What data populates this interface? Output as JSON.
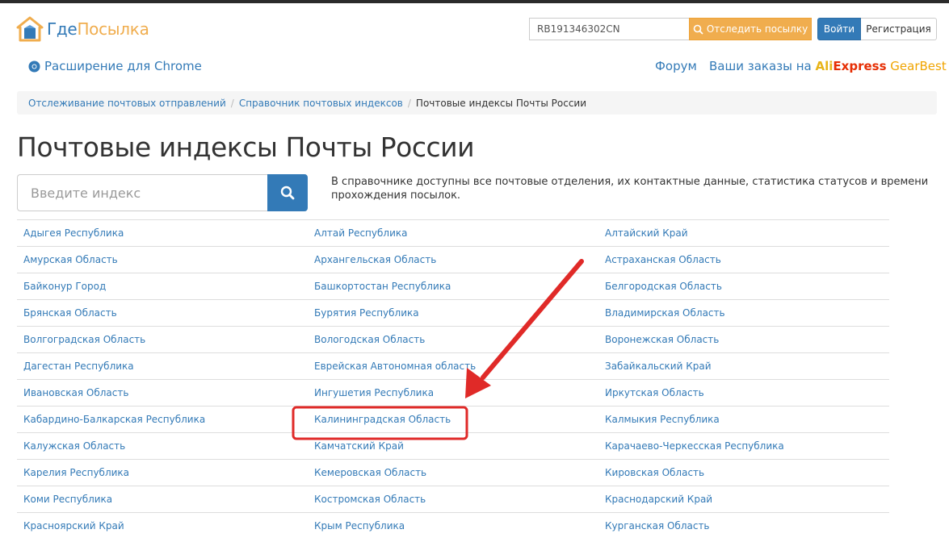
{
  "header": {
    "logo_text_1": "Где",
    "logo_text_2": "Посылка",
    "track_input_value": "RB191346302CN",
    "track_button_label": "Отследить посылку",
    "login_label": "Войти",
    "register_label": "Регистрация"
  },
  "subnav": {
    "chrome_extension": "Расширение для Chrome",
    "forum": "Форум",
    "orders_prefix": "Ваши заказы на",
    "aliexpress_1": "Ali",
    "aliexpress_2": "Express",
    "gearbest": "GearBest"
  },
  "breadcrumb": {
    "item_1": "Отслеживание почтовых отправлений",
    "item_2": "Справочник почтовых индексов",
    "current": "Почтовые индексы Почты России"
  },
  "page": {
    "title": "Почтовые индексы Почты России",
    "search_placeholder": "Введите индекс",
    "description": "В справочнике доступны все почтовые отделения, их контактные данные, статистика статусов и времени прохождения посылок."
  },
  "regions": [
    [
      "Адыгея Республика",
      "Алтай Республика",
      "Алтайский Край"
    ],
    [
      "Амурская Область",
      "Архангельская Область",
      "Астраханская Область"
    ],
    [
      "Байконур Город",
      "Башкортостан Республика",
      "Белгородская Область"
    ],
    [
      "Брянская Область",
      "Бурятия Республика",
      "Владимирская Область"
    ],
    [
      "Волгоградская Область",
      "Вологодская Область",
      "Воронежская Область"
    ],
    [
      "Дагестан Республика",
      "Еврейская Автономная область",
      "Забайкальский Край"
    ],
    [
      "Ивановская Область",
      "Ингушетия Республика",
      "Иркутская Область"
    ],
    [
      "Кабардино-Балкарская Республика",
      "Калининградская Область",
      "Калмыкия Республика"
    ],
    [
      "Калужская Область",
      "Камчатский Край",
      "Карачаево-Черкесская Республика"
    ],
    [
      "Карелия Республика",
      "Кемеровская Область",
      "Кировская Область"
    ],
    [
      "Коми Республика",
      "Костромская Область",
      "Краснодарский Край"
    ],
    [
      "Красноярский Край",
      "Крым Республика",
      "Курганская Область"
    ]
  ],
  "colors": {
    "link": "#337ab7",
    "accent_orange": "#f0ad4e",
    "annotation_red": "#e02a28"
  }
}
